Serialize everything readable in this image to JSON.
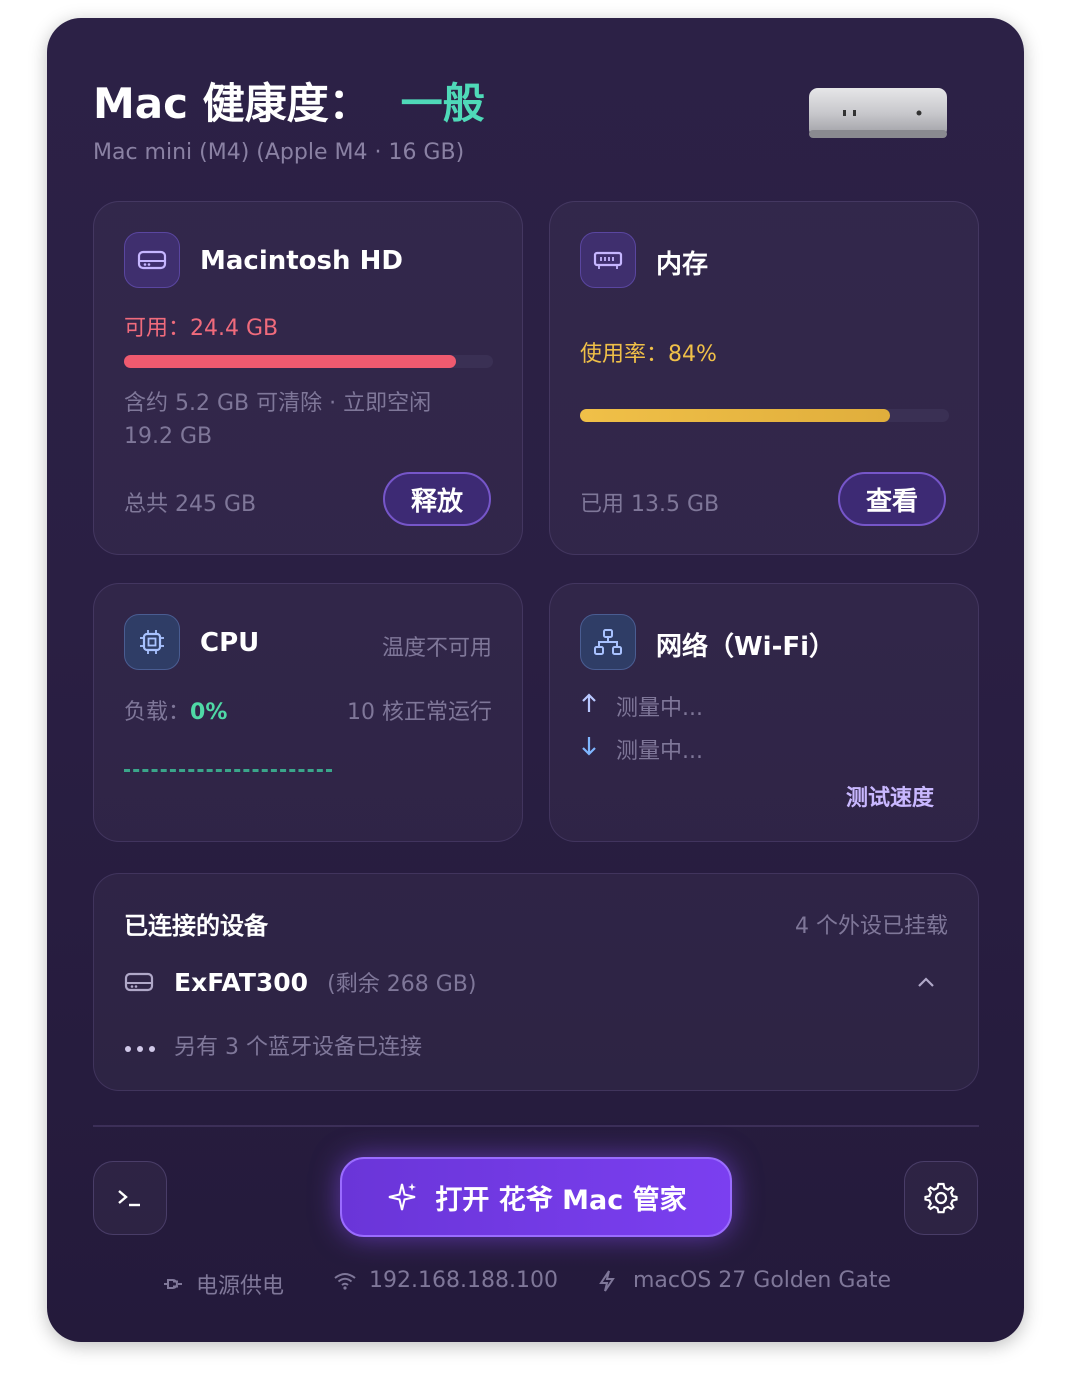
{
  "header": {
    "title": "Mac 健康度：",
    "status": "一般",
    "status_color": "#4fd9b8",
    "subtitle": "Mac mini (M4) (Apple M4 · 16 GB)"
  },
  "disk": {
    "icon": "disk-icon",
    "title": "Macintosh HD",
    "available": "可用：24.4 GB",
    "usage_fraction": 0.9,
    "bar_color": "#ef5a6f",
    "note": "含约 5.2 GB 可清除 · 立即空闲 19.2 GB",
    "total": "总共 245 GB",
    "button": "释放"
  },
  "memory": {
    "icon": "memory-chip-icon",
    "title": "内存",
    "usage": "使用率：84%",
    "usage_fraction": 0.84,
    "bar_color": "#f0c048",
    "used": "已用 13.5 GB",
    "button": "查看"
  },
  "cpu": {
    "icon": "cpu-icon",
    "title": "CPU",
    "temperature": "温度不可用",
    "load_label": "负载：",
    "load_value": "0%",
    "cores": "10 核正常运行"
  },
  "network": {
    "icon": "network-icon",
    "title": "网络（Wi-Fi）",
    "upload": "测量中...",
    "download": "测量中...",
    "speed_test": "测试速度"
  },
  "devices": {
    "title": "已连接的设备",
    "count": "4 个外设已挂载",
    "drive_name": "ExFAT300",
    "drive_free": "(剩余 268 GB)",
    "bluetooth": "另有 3 个蓝牙设备已连接"
  },
  "actions": {
    "terminal_icon": "terminal-icon",
    "main_button": "打开 花爷 Mac 管家",
    "settings_icon": "gear-icon"
  },
  "footer": {
    "power": "电源供电",
    "ip": "192.168.188.100",
    "os": "macOS 27 Golden Gate"
  }
}
